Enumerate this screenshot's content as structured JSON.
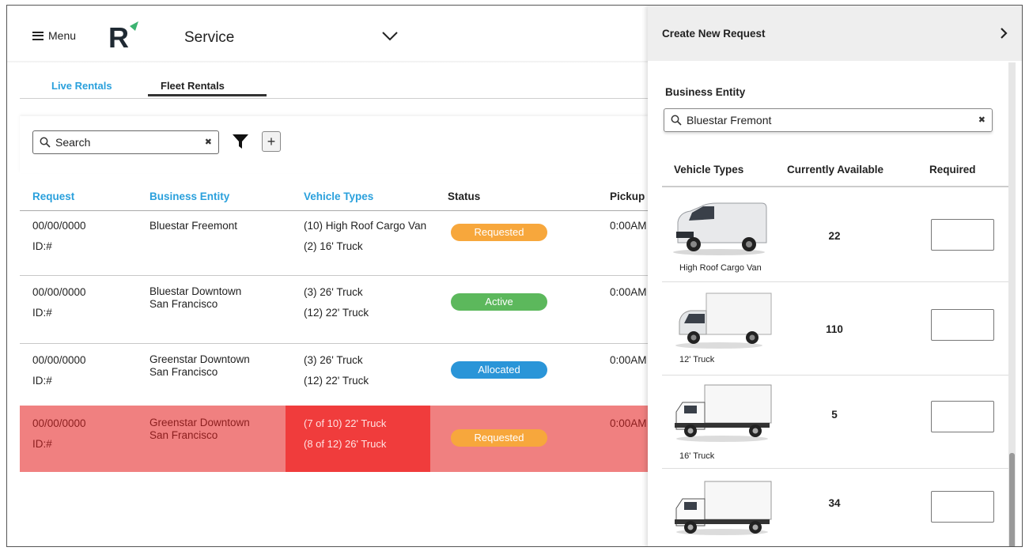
{
  "topbar": {
    "menu_label": "Menu",
    "logo_text": "R",
    "service_label": "Service"
  },
  "tabs": [
    {
      "label": "Live Rentals",
      "active": false
    },
    {
      "label": "Fleet Rentals",
      "active": true
    }
  ],
  "search": {
    "placeholder": "Search",
    "value": ""
  },
  "table": {
    "columns": [
      "Request",
      "Business Entity",
      "Vehicle Types",
      "Status",
      "Pickup"
    ],
    "rows": [
      {
        "date": "00/00/0000",
        "id": "ID:#",
        "entity_line1": "Bluestar Freemont",
        "entity_line2": "",
        "vt1": "(10) High Roof Cargo Van",
        "vt2": "(2) 16' Truck",
        "status": "Requested",
        "pickup": "0:00AM"
      },
      {
        "date": "00/00/0000",
        "id": "ID:#",
        "entity_line1": "Bluestar Downtown",
        "entity_line2": "San Francisco",
        "vt1": "(3) 26' Truck",
        "vt2": "(12) 22' Truck",
        "status": "Active",
        "pickup": "0:00AM"
      },
      {
        "date": "00/00/0000",
        "id": "ID:#",
        "entity_line1": "Greenstar Downtown",
        "entity_line2": "San Francisco",
        "vt1": "(3) 26' Truck",
        "vt2": "(12) 22' Truck",
        "status": "Allocated",
        "pickup": "0:00AM"
      },
      {
        "date": "00/00/0000",
        "id": "ID:#",
        "entity_line1": "Greenstar Downtown",
        "entity_line2": "San Francisco",
        "vt1": "(7 of 10) 22' Truck",
        "vt2": "(8 of 12) 26' Truck",
        "status": "Requested",
        "pickup": "0:00AM"
      }
    ]
  },
  "status_colors": {
    "Requested": "#f7a73c",
    "Active": "#5cb85c",
    "Allocated": "#2a95d8"
  },
  "panel": {
    "title": "Create New Request",
    "business_entity_label": "Business Entity",
    "business_entity_value": "Bluestar Fremont",
    "columns": [
      "Vehicle Types",
      "Currently Available",
      "Required"
    ],
    "vehicles": [
      {
        "name": "High Roof Cargo Van",
        "available": "22",
        "required": ""
      },
      {
        "name": "12' Truck",
        "available": "110",
        "required": ""
      },
      {
        "name": "16' Truck",
        "available": "5",
        "required": ""
      },
      {
        "name": "",
        "available": "34",
        "required": ""
      }
    ]
  },
  "colors": {
    "accent_blue": "#2aa0dc",
    "highlight_row": "#f08080",
    "highlight_cell": "#f03c3c"
  }
}
